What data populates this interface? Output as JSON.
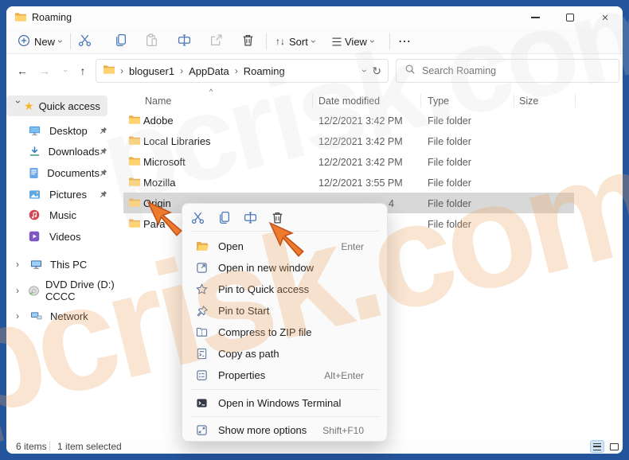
{
  "icons": {
    "back": "←",
    "forward": "→",
    "up": "↑",
    "chevron": "›",
    "refresh": "↻",
    "ellipsis": "⋯",
    "sort_arrows": "↑↓",
    "close": "×",
    "star": "★",
    "caret_up": "^"
  },
  "window": {
    "title": "Roaming"
  },
  "toolbar": {
    "new": "New",
    "sort": "Sort",
    "view": "View"
  },
  "addressbar": {
    "crumbs": [
      "bloguser1",
      "AppData",
      "Roaming"
    ],
    "search_placeholder": "Search Roaming"
  },
  "sidebar": {
    "quick_access": "Quick access",
    "items": [
      {
        "label": "Desktop"
      },
      {
        "label": "Downloads"
      },
      {
        "label": "Documents"
      },
      {
        "label": "Pictures"
      },
      {
        "label": "Music"
      },
      {
        "label": "Videos"
      }
    ],
    "tree": [
      {
        "label": "This PC"
      },
      {
        "label": "DVD Drive (D:) CCCC"
      },
      {
        "label": "Network"
      }
    ]
  },
  "filelist": {
    "columns": {
      "name": "Name",
      "date": "Date modified",
      "type": "Type",
      "size": "Size"
    },
    "rows": [
      {
        "name": "Adobe",
        "date": "12/2/2021 3:42 PM",
        "type": "File folder"
      },
      {
        "name": "Local Libraries",
        "date": "12/2/2021 3:42 PM",
        "type": "File folder"
      },
      {
        "name": "Microsoft",
        "date": "12/2/2021 3:42 PM",
        "type": "File folder"
      },
      {
        "name": "Mozilla",
        "date": "12/2/2021 3:55 PM",
        "type": "File folder"
      },
      {
        "name": "Origin",
        "date_visible": "4",
        "type": "File folder"
      },
      {
        "name": "Para",
        "type": "File folder"
      }
    ]
  },
  "context_menu": {
    "items": [
      {
        "label": "Open",
        "shortcut": "Enter"
      },
      {
        "label": "Open in new window",
        "shortcut": ""
      },
      {
        "label": "Pin to Quick access",
        "shortcut": ""
      },
      {
        "label": "Pin to Start",
        "shortcut": ""
      },
      {
        "label": "Compress to ZIP file",
        "shortcut": ""
      },
      {
        "label": "Copy as path",
        "shortcut": ""
      },
      {
        "label": "Properties",
        "shortcut": "Alt+Enter"
      },
      {
        "label": "Open in Windows Terminal",
        "shortcut": ""
      },
      {
        "label": "Show more options",
        "shortcut": "Shift+F10"
      }
    ]
  },
  "statusbar": {
    "count": "6 items",
    "selection": "1 item selected"
  },
  "watermark": "pcrisk.com",
  "colors": {
    "frame_blue": "#24549b",
    "accent_blue": "#4878b8",
    "folder_yellow": "#ffd36f",
    "arrow_orange": "#ed7a2d",
    "selection_gray": "#d8d8d8"
  }
}
